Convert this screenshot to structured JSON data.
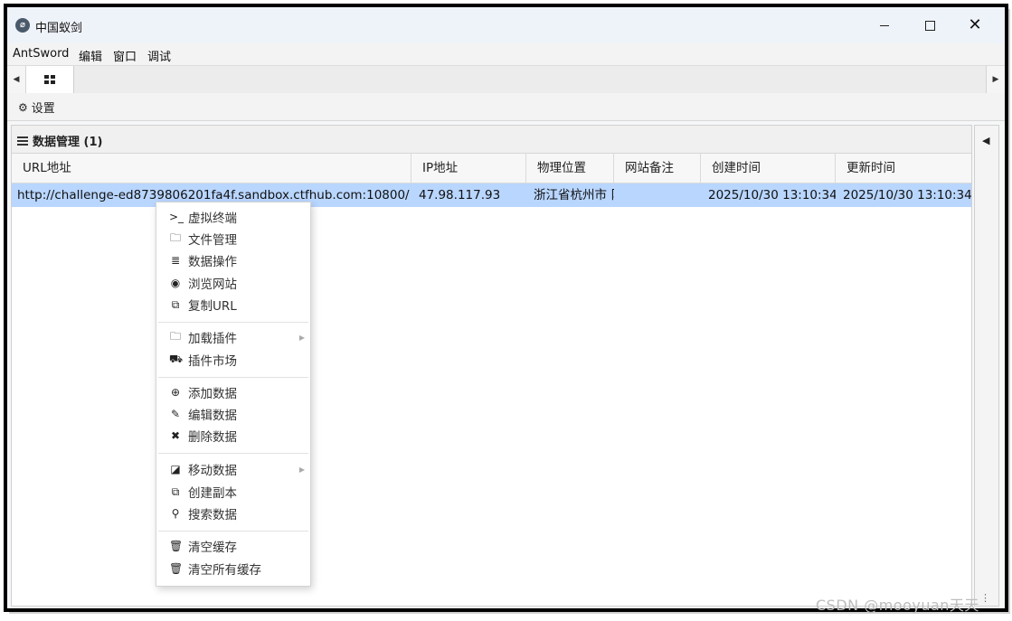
{
  "window": {
    "title": "中国蚁剑",
    "app_icon_glyph": "⌀"
  },
  "menu": {
    "items": [
      "AntSword",
      "编辑",
      "窗口",
      "调试"
    ]
  },
  "toolbar": {
    "settings_label": "设置"
  },
  "panel": {
    "title": "数据管理 (1)"
  },
  "table": {
    "columns": [
      "URL地址",
      "IP地址",
      "物理位置",
      "网站备注",
      "创建时间",
      "更新时间"
    ],
    "rows": [
      {
        "url": "http://challenge-ed8739806201fa4f.sandbox.ctfhub.com:10800/",
        "ip": "47.98.117.93",
        "location": "浙江省杭州市 阝",
        "note": "",
        "created": "2025/10/30 13:10:34",
        "updated": "2025/10/30 13:10:34"
      }
    ],
    "selected_row": 0
  },
  "context_menu": {
    "groups": [
      [
        {
          "label": "虚拟终端",
          "icon": "terminal-icon",
          "glyph": ">_"
        },
        {
          "label": "文件管理",
          "icon": "folder-icon",
          "glyph": "🗀"
        },
        {
          "label": "数据操作",
          "icon": "database-icon",
          "glyph": "≣"
        },
        {
          "label": "浏览网站",
          "icon": "chrome-icon",
          "glyph": "◉"
        },
        {
          "label": "复制URL",
          "icon": "copy-icon",
          "glyph": "⧉"
        }
      ],
      [
        {
          "label": "加载插件",
          "icon": "folder-icon",
          "glyph": "🗀",
          "submenu": true
        },
        {
          "label": "插件市场",
          "icon": "cart-icon",
          "glyph": "⛟"
        }
      ],
      [
        {
          "label": "添加数据",
          "icon": "plus-circle-icon",
          "glyph": "⊕"
        },
        {
          "label": "编辑数据",
          "icon": "edit-icon",
          "glyph": "✎"
        },
        {
          "label": "删除数据",
          "icon": "close-icon",
          "glyph": "✖"
        }
      ],
      [
        {
          "label": "移动数据",
          "icon": "move-icon",
          "glyph": "◪",
          "submenu": true
        },
        {
          "label": "创建副本",
          "icon": "copy-icon",
          "glyph": "⧉"
        },
        {
          "label": "搜索数据",
          "icon": "search-icon",
          "glyph": "⚲"
        }
      ],
      [
        {
          "label": "清空缓存",
          "icon": "trash-outline-icon",
          "glyph": "🗑"
        },
        {
          "label": "清空所有缓存",
          "icon": "trash-icon",
          "glyph": "🗑"
        }
      ]
    ]
  },
  "watermark": "CSDN @mooyuan天天"
}
